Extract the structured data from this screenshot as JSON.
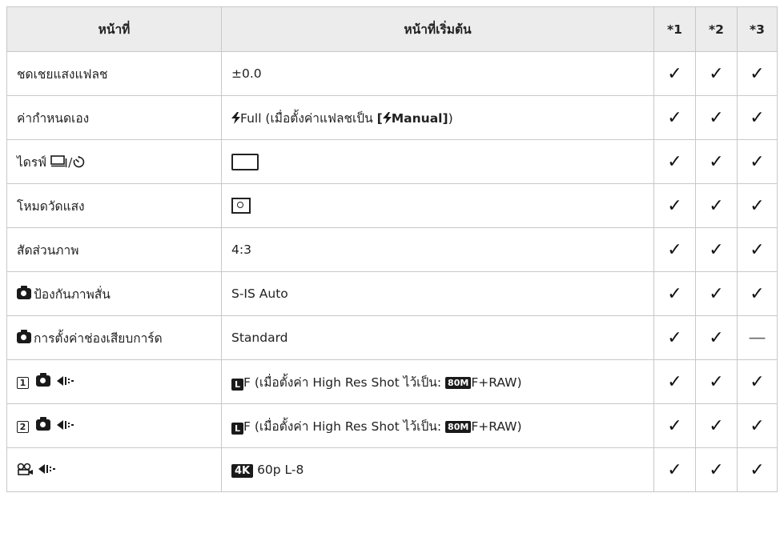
{
  "header": {
    "function": "หน้าที่",
    "default": "หน้าที่เริ่มต้น",
    "c1": "*1",
    "c2": "*2",
    "c3": "*3"
  },
  "rows": [
    {
      "fn": "ชดเชยแสงแฟลช",
      "val": "±0.0",
      "c1": "✓",
      "c2": "✓",
      "c3": "✓"
    },
    {
      "fn": "ค่ากำหนดเอง",
      "val_pre": "Full (เมื่อตั้งค่าแฟลชเป็น ",
      "val_bracket_open": "[",
      "val_bold": "Manual]",
      "val_post": ")",
      "c1": "✓",
      "c2": "✓",
      "c3": "✓"
    },
    {
      "fn": "ไดรฟ์ ",
      "fn_sep": "/",
      "c1": "✓",
      "c2": "✓",
      "c3": "✓"
    },
    {
      "fn": "โหมดวัดแสง",
      "c1": "✓",
      "c2": "✓",
      "c3": "✓"
    },
    {
      "fn": "สัดส่วนภาพ",
      "val": "4:3",
      "c1": "✓",
      "c2": "✓",
      "c3": "✓"
    },
    {
      "fn": "ป้องกันภาพสั่น",
      "val": "S-IS Auto",
      "c1": "✓",
      "c2": "✓",
      "c3": "✓"
    },
    {
      "fn": "การตั้งค่าช่องเสียบการ์ด",
      "val": "Standard",
      "c1": "✓",
      "c2": "✓",
      "c3": "—"
    },
    {
      "num": "1",
      "val_pre": "F (เมื่อตั้งค่า High Res Shot ไว้เป็น: ",
      "val_badge": "80M",
      "val_post": "F+RAW)",
      "c1": "✓",
      "c2": "✓",
      "c3": "✓"
    },
    {
      "num": "2",
      "val_pre": "F (เมื่อตั้งค่า High Res Shot ไว้เป็น: ",
      "val_badge": "80M",
      "val_post": "F+RAW)",
      "c1": "✓",
      "c2": "✓",
      "c3": "✓"
    },
    {
      "val_badge": "4K",
      "val_post": "60p L-8",
      "c1": "✓",
      "c2": "✓",
      "c3": "✓"
    }
  ],
  "icons": {
    "flash": "flash-icon",
    "camera": "camera-icon",
    "image-quality": "image-quality-icon",
    "movie": "movie-icon",
    "sequential": "sequential-shooting-icon",
    "self-timer": "self-timer-icon",
    "single-frame": "single-frame-icon",
    "metering": "ese-metering-icon",
    "large": "large-size-icon"
  }
}
